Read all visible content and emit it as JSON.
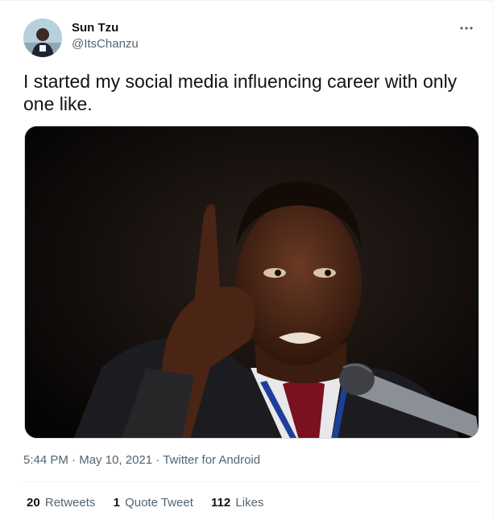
{
  "author": {
    "display_name": "Sun Tzu",
    "handle": "@ItsChanzu",
    "avatar_icon": "user-avatar"
  },
  "more_menu_icon": "ellipsis-icon",
  "tweet": {
    "text": "I started my social media influencing career with only one like."
  },
  "media": {
    "description_icon": "photo-man-pointing-up"
  },
  "meta": {
    "time": "5:44 PM",
    "separator": "·",
    "date": "May 10, 2021",
    "source": "Twitter for Android"
  },
  "stats": {
    "retweets_count": "20",
    "retweets_label": "Retweets",
    "quotes_count": "1",
    "quotes_label": "Quote Tweet",
    "likes_count": "112",
    "likes_label": "Likes"
  },
  "colors": {
    "text_primary": "#0f1419",
    "text_secondary": "#536471",
    "divider": "#eff3f4",
    "background": "#ffffff"
  }
}
